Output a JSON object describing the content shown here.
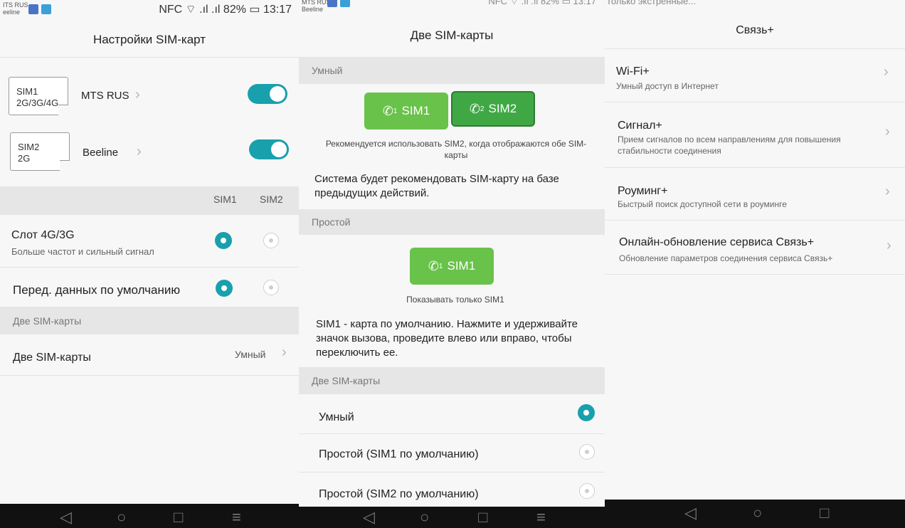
{
  "screen1": {
    "status": {
      "carrier": "ITS RUS",
      "carrier2": "eeline",
      "right": "NFC ⌔ .ıl .ıl 82% ▭ 13:17"
    },
    "title": "Настройки SIM-карт",
    "sims": [
      {
        "card": "SIM1",
        "bands": "2G/3G/4G",
        "operator": "MTS RUS",
        "enabled": true
      },
      {
        "card": "SIM2",
        "bands": "2G",
        "operator": "Beeline",
        "enabled": true
      }
    ],
    "header_cols": {
      "sim1": "SIM1",
      "sim2": "SIM2"
    },
    "slot": {
      "label": "Слот 4G/3G",
      "sub": "Больше частот и сильный сигнал",
      "selected": "SIM1"
    },
    "data": {
      "label": "Перед. данных по умолчанию",
      "selected": "SIM1"
    },
    "section_dual": "Две SIM-карты",
    "dual": {
      "label": "Две SIM-карты",
      "value": "Умный"
    }
  },
  "screen2": {
    "status": {
      "carrier": "MTS RUS",
      "carrier2": "Beeline",
      "right": "NFC ⌔ .ıl .ıl 82% ▭ 13:17"
    },
    "title": "Две SIM-карты",
    "section_smart": "Умный",
    "smart_buttons": [
      {
        "label": "SIM1",
        "num": "1",
        "selected": false
      },
      {
        "label": "SIM2",
        "num": "2",
        "selected": true
      }
    ],
    "smart_hint": "Рекомендуется использовать SIM2, когда отображаются обе SIM-карты",
    "smart_desc": "Система будет рекомендовать SIM-карту на базе предыдущих действий.",
    "section_simple": "Простой",
    "simple_button": {
      "label": "SIM1",
      "num": "1"
    },
    "simple_hint": "Показывать только SIM1",
    "simple_desc": "SIM1 - карта по умолчанию. Нажмите и удерживайте значок вызова, проведите влево или вправо, чтобы переключить ее.",
    "section_dual": "Две SIM-карты",
    "options": [
      {
        "label": "Умный",
        "selected": true
      },
      {
        "label": "Простой (SIM1 по умолчанию)",
        "selected": false
      },
      {
        "label": "Простой (SIM2 по умолчанию)",
        "selected": false
      }
    ]
  },
  "screen3": {
    "status": {
      "left": "Только экстренные..."
    },
    "title": "Связь+",
    "items": [
      {
        "label": "Wi-Fi+",
        "sub": "Умный доступ в Интернет"
      },
      {
        "label": "Сигнал+",
        "sub": "Прием сигналов по всем направлениям для повышения стабильности соединения"
      },
      {
        "label": "Роуминг+",
        "sub": "Быстрый поиск доступной сети в роуминге"
      },
      {
        "label": "Онлайн-обновление сервиса Связь+",
        "sub": "Обновление параметров соединения сервиса Связь+"
      }
    ]
  },
  "colors": {
    "accent": "#18a0ad",
    "sim_green": "#69c24a",
    "sim_green_selected": "#3fa845"
  }
}
